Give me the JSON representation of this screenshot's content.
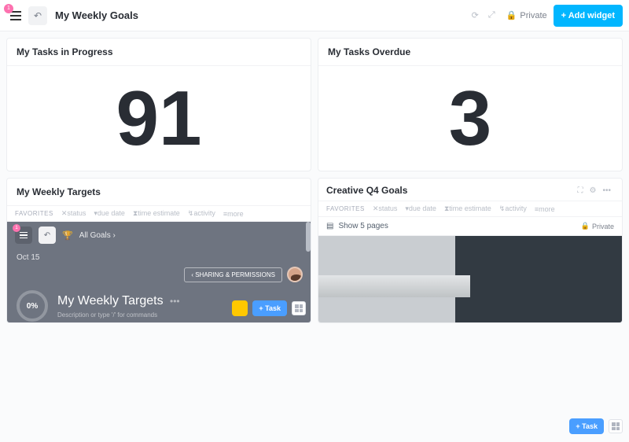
{
  "header": {
    "badge": "1",
    "title": "My Weekly Goals",
    "privacy_label": "Private",
    "add_widget_label": "+ Add widget"
  },
  "cards": {
    "tasks_progress": {
      "title": "My Tasks in Progress",
      "value": "91"
    },
    "tasks_overdue": {
      "title": "My Tasks Overdue",
      "value": "3"
    },
    "weekly_targets": {
      "title": "My Weekly Targets"
    },
    "creative_q4": {
      "title": "Creative Q4 Goals"
    }
  },
  "filters": {
    "favorites": "FAVORITES",
    "status": "✕status",
    "due_date": "▾due date",
    "time_estimate": "⧗time estimate",
    "activity": "↯activity",
    "more": "≡more"
  },
  "filtersQ4": {
    "favorites": "FAVORITES",
    "status": "✕status",
    "due_date": "▾due date",
    "time_estimate": "⧗time estimate",
    "activity": "↯activity",
    "more": "≡more"
  },
  "weekly_embed": {
    "badge": "1",
    "all_goals": "All Goals  ›",
    "date": "Oct 15",
    "share_btn": "‹  SHARING & PERMISSIONS",
    "progress": "0%",
    "goal_title": "My Weekly Targets",
    "more": "•••",
    "desc_hint": "Description or type '/' for commands",
    "task_btn": "+ Task"
  },
  "creative_embed": {
    "show_pages": "Show 5 pages",
    "private": "Private"
  },
  "float": {
    "task_btn": "+ Task"
  }
}
